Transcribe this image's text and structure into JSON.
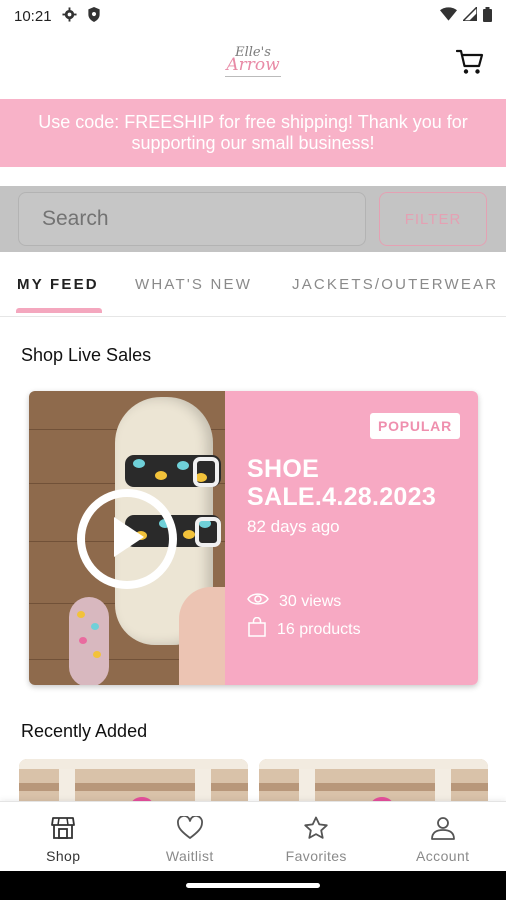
{
  "status_bar": {
    "time": "10:21"
  },
  "header": {
    "logo_line1": "Elle's",
    "logo_line2": "Arrow"
  },
  "promo": {
    "text": "Use code: FREESHIP for free shipping! Thank you for supporting our small business!"
  },
  "search": {
    "placeholder": "Search",
    "filter_label": "FILTER"
  },
  "tabs": [
    {
      "label": "MY FEED",
      "active": true
    },
    {
      "label": "WHAT'S NEW",
      "active": false
    },
    {
      "label": "JACKETS/OUTERWEAR",
      "active": false
    }
  ],
  "live_sales": {
    "section_title": "Shop Live Sales",
    "card": {
      "badge": "POPULAR",
      "title": "SHOE SALE.4.28.2023",
      "age": "82 days ago",
      "views": "30 views",
      "products": "16 products"
    }
  },
  "recently_added": {
    "section_title": "Recently Added"
  },
  "bottom_nav": [
    {
      "label": "Shop",
      "icon": "store-icon"
    },
    {
      "label": "Waitlist",
      "icon": "heart-icon"
    },
    {
      "label": "Favorites",
      "icon": "star-icon"
    },
    {
      "label": "Account",
      "icon": "person-icon"
    }
  ],
  "colors": {
    "brand_pink": "#f7a9c3",
    "promo_pink": "#f8b2c8",
    "search_overlay": "#c3c3c3"
  }
}
